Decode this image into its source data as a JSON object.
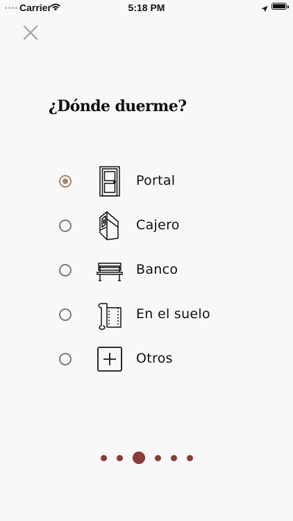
{
  "status_bar": {
    "carrier": "Carrier",
    "time": "5:18 PM",
    "icons": [
      "wifi-icon",
      "location-arrow-icon",
      "battery-icon"
    ]
  },
  "close_icon": "close-icon",
  "title": "¿Dónde duerme?",
  "options": [
    {
      "label": "Portal",
      "icon": "door-icon",
      "selected": true
    },
    {
      "label": "Cajero",
      "icon": "atm-icon",
      "selected": false
    },
    {
      "label": "Banco",
      "icon": "bench-icon",
      "selected": false
    },
    {
      "label": "En el suelo",
      "icon": "cardboard-mat-icon",
      "selected": false
    },
    {
      "label": "Otros",
      "icon": "plus-box-icon",
      "selected": false
    }
  ],
  "pagination": {
    "total": 6,
    "current": 3
  },
  "colors": {
    "accent_radio": "#a7876b",
    "dots": "#8c3a34",
    "background": "#f8f8f8"
  }
}
